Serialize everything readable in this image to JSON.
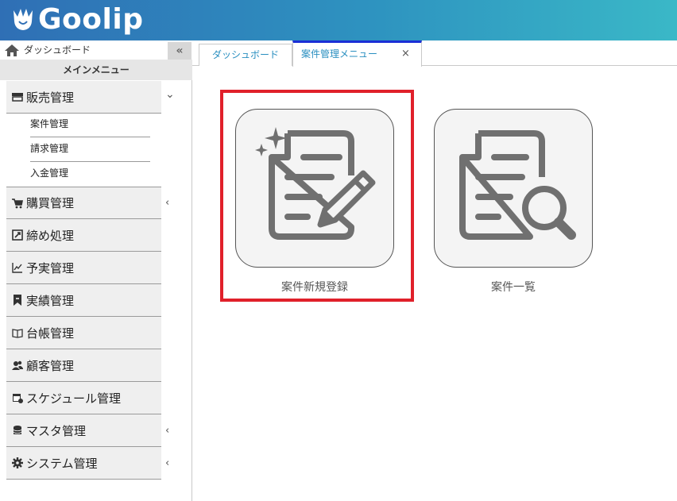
{
  "header": {
    "logo_text": "Goolip"
  },
  "sidebar": {
    "dashboard_label": "ダッシュボード",
    "collapse_glyph": "«",
    "main_menu_label": "メインメニュー",
    "items": [
      {
        "label": "販売管理",
        "icon": "store-icon",
        "chevron": "⌄"
      },
      {
        "label": "購買管理",
        "icon": "cart-icon",
        "chevron": "‹"
      },
      {
        "label": "締め処理",
        "icon": "closing-icon"
      },
      {
        "label": "予実管理",
        "icon": "chart-icon"
      },
      {
        "label": "実績管理",
        "icon": "bookmark-icon"
      },
      {
        "label": "台帳管理",
        "icon": "book-icon"
      },
      {
        "label": "顧客管理",
        "icon": "users-icon"
      },
      {
        "label": "スケジュール管理",
        "icon": "calendar-icon"
      },
      {
        "label": "マスタ管理",
        "icon": "database-icon",
        "chevron": "‹"
      },
      {
        "label": "システム管理",
        "icon": "gear-icon",
        "chevron": "‹"
      }
    ],
    "sub_items": [
      "案件管理",
      "請求管理",
      "入金管理"
    ]
  },
  "tabs": [
    {
      "label": "ダッシュボード"
    },
    {
      "label": "案件管理メニュー",
      "close": "×"
    }
  ],
  "cards": [
    {
      "label": "案件新規登録",
      "icon": "new-case-icon"
    },
    {
      "label": "案件一覧",
      "icon": "case-list-icon"
    }
  ],
  "colors": {
    "highlight": "#e0202a",
    "active_tab": "#1a2fd6",
    "header_start": "#2f6fb5",
    "header_end": "#3ab8c7"
  }
}
